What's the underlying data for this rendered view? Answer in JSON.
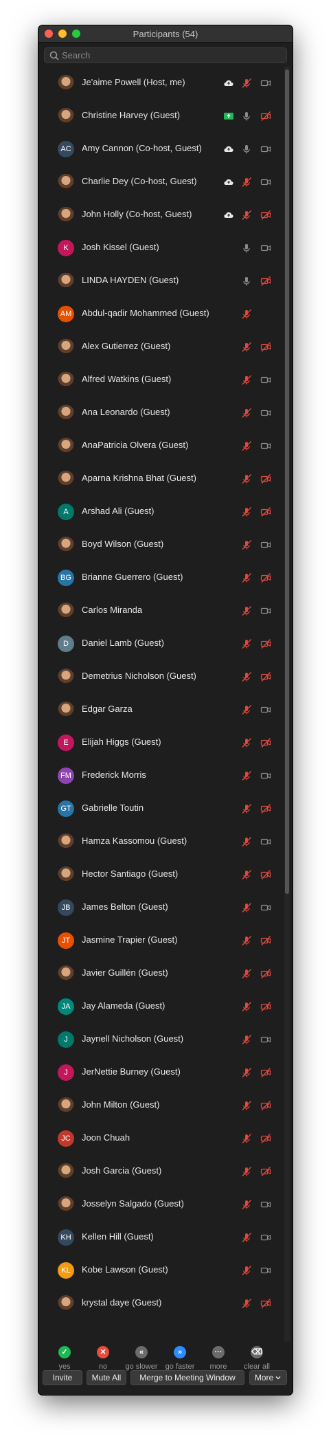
{
  "window": {
    "title": "Participants (54)"
  },
  "search": {
    "placeholder": "Search"
  },
  "participants": [
    {
      "name": "Je'aime Powell (Host, me)",
      "initials": "",
      "color": "",
      "photo": true,
      "cloud": true,
      "share": false,
      "mic": "muted",
      "cam": "on"
    },
    {
      "name": "Christine Harvey (Guest)",
      "initials": "",
      "color": "",
      "photo": true,
      "cloud": false,
      "share": true,
      "mic": "on",
      "cam": "off"
    },
    {
      "name": "Amy Cannon (Co-host, Guest)",
      "initials": "AC",
      "color": "#34495e",
      "photo": false,
      "cloud": true,
      "share": false,
      "mic": "on",
      "cam": "on"
    },
    {
      "name": "Charlie Dey (Co-host, Guest)",
      "initials": "",
      "color": "",
      "photo": true,
      "cloud": true,
      "share": false,
      "mic": "muted",
      "cam": "on"
    },
    {
      "name": "John Holly (Co-host, Guest)",
      "initials": "",
      "color": "",
      "photo": true,
      "cloud": true,
      "share": false,
      "mic": "muted",
      "cam": "off"
    },
    {
      "name": "Josh Kissel (Guest)",
      "initials": "K",
      "color": "#c2185b",
      "photo": false,
      "cloud": false,
      "share": false,
      "mic": "on",
      "cam": "on"
    },
    {
      "name": "LINDA HAYDEN (Guest)",
      "initials": "",
      "color": "",
      "photo": true,
      "cloud": false,
      "share": false,
      "mic": "on",
      "cam": "off"
    },
    {
      "name": "Abdul-qadir Mohammed (Guest)",
      "initials": "AM",
      "color": "#e65100",
      "photo": false,
      "cloud": false,
      "share": false,
      "mic": "muted",
      "cam": "none"
    },
    {
      "name": "Alex Gutierrez (Guest)",
      "initials": "",
      "color": "",
      "photo": true,
      "cloud": false,
      "share": false,
      "mic": "muted",
      "cam": "off"
    },
    {
      "name": "Alfred Watkins (Guest)",
      "initials": "",
      "color": "",
      "photo": true,
      "cloud": false,
      "share": false,
      "mic": "muted",
      "cam": "on"
    },
    {
      "name": "Ana Leonardo (Guest)",
      "initials": "",
      "color": "",
      "photo": true,
      "cloud": false,
      "share": false,
      "mic": "muted",
      "cam": "on"
    },
    {
      "name": "AnaPatricia Olvera (Guest)",
      "initials": "",
      "color": "",
      "photo": true,
      "cloud": false,
      "share": false,
      "mic": "muted",
      "cam": "on"
    },
    {
      "name": "Aparna Krishna Bhat (Guest)",
      "initials": "",
      "color": "",
      "photo": true,
      "cloud": false,
      "share": false,
      "mic": "muted",
      "cam": "off"
    },
    {
      "name": "Arshad Ali (Guest)",
      "initials": "A",
      "color": "#00796b",
      "photo": false,
      "cloud": false,
      "share": false,
      "mic": "muted",
      "cam": "off"
    },
    {
      "name": "Boyd Wilson (Guest)",
      "initials": "",
      "color": "",
      "photo": true,
      "cloud": false,
      "share": false,
      "mic": "muted",
      "cam": "on"
    },
    {
      "name": "Brianne Guerrero (Guest)",
      "initials": "BG",
      "color": "#2874a6",
      "photo": false,
      "cloud": false,
      "share": false,
      "mic": "muted",
      "cam": "off"
    },
    {
      "name": "Carlos Miranda",
      "initials": "",
      "color": "",
      "photo": true,
      "cloud": false,
      "share": false,
      "mic": "muted",
      "cam": "on"
    },
    {
      "name": "Daniel Lamb (Guest)",
      "initials": "D",
      "color": "#607d8b",
      "photo": false,
      "cloud": false,
      "share": false,
      "mic": "muted",
      "cam": "off"
    },
    {
      "name": "Demetrius Nicholson (Guest)",
      "initials": "",
      "color": "",
      "photo": true,
      "cloud": false,
      "share": false,
      "mic": "muted",
      "cam": "off"
    },
    {
      "name": "Edgar Garza",
      "initials": "",
      "color": "",
      "photo": true,
      "cloud": false,
      "share": false,
      "mic": "muted",
      "cam": "on"
    },
    {
      "name": "Elijah Higgs (Guest)",
      "initials": "E",
      "color": "#c2185b",
      "photo": false,
      "cloud": false,
      "share": false,
      "mic": "muted",
      "cam": "off"
    },
    {
      "name": "Frederick Morris",
      "initials": "FM",
      "color": "#8e44ad",
      "photo": false,
      "cloud": false,
      "share": false,
      "mic": "muted",
      "cam": "on"
    },
    {
      "name": "Gabrielle Toutin",
      "initials": "GT",
      "color": "#2874a6",
      "photo": false,
      "cloud": false,
      "share": false,
      "mic": "muted",
      "cam": "off"
    },
    {
      "name": "Hamza Kassomou (Guest)",
      "initials": "",
      "color": "",
      "photo": true,
      "cloud": false,
      "share": false,
      "mic": "muted",
      "cam": "on"
    },
    {
      "name": "Hector Santiago (Guest)",
      "initials": "",
      "color": "",
      "photo": true,
      "cloud": false,
      "share": false,
      "mic": "muted",
      "cam": "off"
    },
    {
      "name": "James Belton (Guest)",
      "initials": "JB",
      "color": "#34495e",
      "photo": false,
      "cloud": false,
      "share": false,
      "mic": "muted",
      "cam": "on"
    },
    {
      "name": "Jasmine Trapier (Guest)",
      "initials": "JT",
      "color": "#e65100",
      "photo": false,
      "cloud": false,
      "share": false,
      "mic": "muted",
      "cam": "off"
    },
    {
      "name": "Javier Guillén (Guest)",
      "initials": "",
      "color": "",
      "photo": true,
      "cloud": false,
      "share": false,
      "mic": "muted",
      "cam": "off"
    },
    {
      "name": "Jay Alameda (Guest)",
      "initials": "JA",
      "color": "#00897b",
      "photo": false,
      "cloud": false,
      "share": false,
      "mic": "muted",
      "cam": "off"
    },
    {
      "name": "Jaynell Nicholson (Guest)",
      "initials": "J",
      "color": "#00796b",
      "photo": false,
      "cloud": false,
      "share": false,
      "mic": "muted",
      "cam": "on"
    },
    {
      "name": "JerNettie Burney (Guest)",
      "initials": "J",
      "color": "#c2185b",
      "photo": false,
      "cloud": false,
      "share": false,
      "mic": "muted",
      "cam": "off"
    },
    {
      "name": "John Milton (Guest)",
      "initials": "",
      "color": "",
      "photo": true,
      "cloud": false,
      "share": false,
      "mic": "muted",
      "cam": "off"
    },
    {
      "name": "Joon Chuah",
      "initials": "JC",
      "color": "#c0392b",
      "photo": false,
      "cloud": false,
      "share": false,
      "mic": "muted",
      "cam": "off"
    },
    {
      "name": "Josh Garcia (Guest)",
      "initials": "",
      "color": "",
      "photo": true,
      "cloud": false,
      "share": false,
      "mic": "muted",
      "cam": "off"
    },
    {
      "name": "Josselyn Salgado (Guest)",
      "initials": "",
      "color": "",
      "photo": true,
      "cloud": false,
      "share": false,
      "mic": "muted",
      "cam": "on"
    },
    {
      "name": "Kellen Hill (Guest)",
      "initials": "KH",
      "color": "#34495e",
      "photo": false,
      "cloud": false,
      "share": false,
      "mic": "muted",
      "cam": "on"
    },
    {
      "name": "Kobe Lawson (Guest)",
      "initials": "KL",
      "color": "#f39c12",
      "photo": false,
      "cloud": false,
      "share": false,
      "mic": "muted",
      "cam": "on"
    },
    {
      "name": "krystal daye (Guest)",
      "initials": "",
      "color": "",
      "photo": true,
      "cloud": false,
      "share": false,
      "mic": "muted",
      "cam": "off"
    }
  ],
  "reactions": [
    {
      "label": "yes",
      "color": "#1db954",
      "glyph": "✓"
    },
    {
      "label": "no",
      "color": "#e74c3c",
      "glyph": "✕"
    },
    {
      "label": "go slower",
      "color": "#6b6b6b",
      "glyph": "«"
    },
    {
      "label": "go faster",
      "color": "#2d8cff",
      "glyph": "»"
    },
    {
      "label": "more",
      "color": "#6b6b6b",
      "glyph": "···"
    },
    {
      "label": "clear all",
      "color": "#6b6b6b",
      "glyph": "⌫"
    }
  ],
  "footer": {
    "invite": "Invite",
    "mute_all": "Mute All",
    "merge": "Merge to Meeting Window",
    "more": "More"
  },
  "colors": {
    "muted_red": "#e0483e",
    "icon_grey": "#8a8a8a",
    "share_green": "#1db954"
  }
}
